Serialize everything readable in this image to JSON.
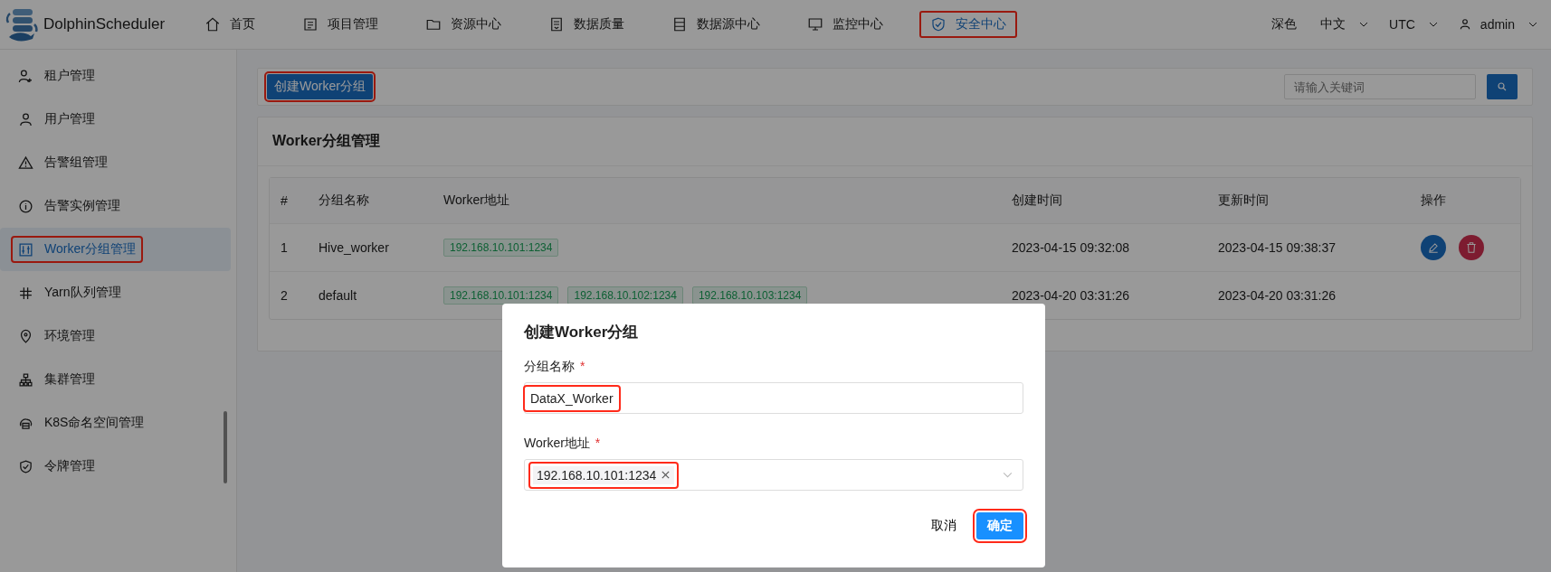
{
  "header": {
    "logo": "DolphinScheduler",
    "nav": [
      {
        "label": "首页",
        "selected": false,
        "highlighted": false
      },
      {
        "label": "项目管理",
        "selected": false,
        "highlighted": false
      },
      {
        "label": "资源中心",
        "selected": false,
        "highlighted": false
      },
      {
        "label": "数据质量",
        "selected": false,
        "highlighted": false
      },
      {
        "label": "数据源中心",
        "selected": false,
        "highlighted": false
      },
      {
        "label": "监控中心",
        "selected": false,
        "highlighted": false
      },
      {
        "label": "安全中心",
        "selected": true,
        "highlighted": true
      }
    ],
    "theme": "深色",
    "language": "中文",
    "timezone": "UTC",
    "user": "admin"
  },
  "sidebar": {
    "items": [
      {
        "label": "租户管理",
        "selected": false,
        "highlighted": false
      },
      {
        "label": "用户管理",
        "selected": false,
        "highlighted": false
      },
      {
        "label": "告警组管理",
        "selected": false,
        "highlighted": false
      },
      {
        "label": "告警实例管理",
        "selected": false,
        "highlighted": false
      },
      {
        "label": "Worker分组管理",
        "selected": true,
        "highlighted": true
      },
      {
        "label": "Yarn队列管理",
        "selected": false,
        "highlighted": false
      },
      {
        "label": "环境管理",
        "selected": false,
        "highlighted": false
      },
      {
        "label": "集群管理",
        "selected": false,
        "highlighted": false
      },
      {
        "label": "K8S命名空间管理",
        "selected": false,
        "highlighted": false
      },
      {
        "label": "令牌管理",
        "selected": false,
        "highlighted": false
      }
    ]
  },
  "toolbar": {
    "create_button": {
      "label": "创建Worker分组",
      "highlighted": true
    },
    "search": {
      "placeholder": "请输入关键词"
    }
  },
  "panel": {
    "title": "Worker分组管理",
    "table": {
      "columns": [
        "#",
        "分组名称",
        "Worker地址",
        "创建时间",
        "更新时间",
        "操作"
      ],
      "rows": [
        {
          "index": "1",
          "name": "Hive_worker",
          "addresses": [
            "192.168.10.101:1234"
          ],
          "created": "2023-04-15 09:32:08",
          "updated": "2023-04-15 09:38:37",
          "editable": true
        },
        {
          "index": "2",
          "name": "default",
          "addresses": [
            "192.168.10.101:1234",
            "192.168.10.102:1234",
            "192.168.10.103:1234"
          ],
          "created": "2023-04-20 03:31:26",
          "updated": "2023-04-20 03:31:26",
          "editable": false
        }
      ]
    }
  },
  "dialog": {
    "title": "创建Worker分组",
    "fields": [
      {
        "kind": "text",
        "label": "分组名称",
        "required_mark": "*",
        "value": "DataX_Worker",
        "highlighted": true
      },
      {
        "kind": "select",
        "label": "Worker地址",
        "required_mark": "*",
        "tags": [
          "192.168.10.101:1234"
        ],
        "highlighted": true
      }
    ],
    "cancel": {
      "label": "取消"
    },
    "confirm": {
      "label": "确定",
      "highlighted": true
    }
  }
}
